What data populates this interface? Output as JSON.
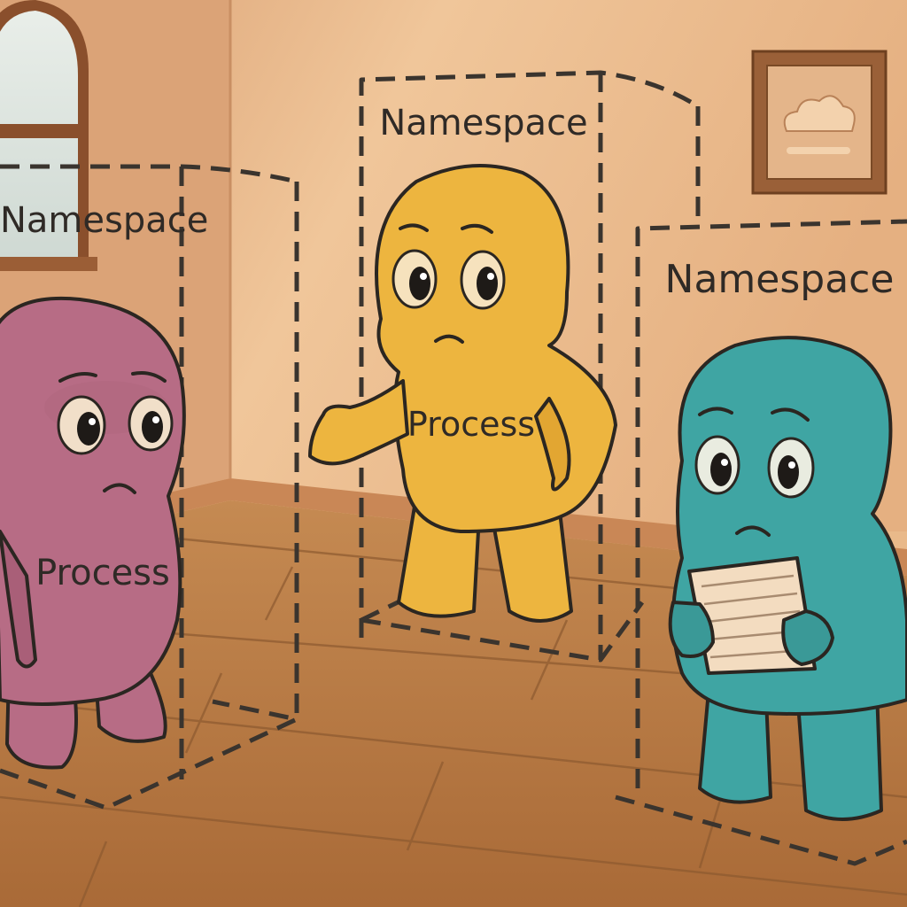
{
  "scene": {
    "namespaces": [
      {
        "label": "Namespace",
        "process_label": "Process",
        "body_color": "#b76c85"
      },
      {
        "label": "Namespace",
        "process_label": "Process",
        "body_color": "#edb53f"
      },
      {
        "label": "Namespace",
        "body_color": "#3fa5a3"
      }
    ],
    "colors": {
      "wall": "#eab98b",
      "floor": "#b97a45",
      "dashes": "#3a342e"
    },
    "icons": [
      "window",
      "framed-cloud-picture",
      "paper-note"
    ]
  }
}
